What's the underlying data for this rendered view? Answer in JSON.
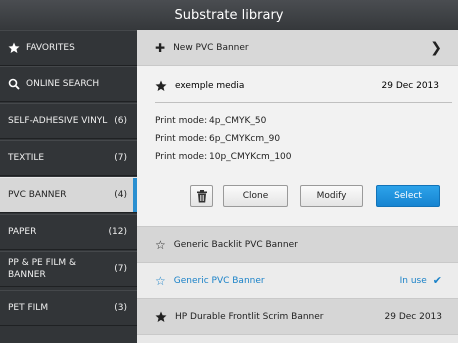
{
  "title": "Substrate library",
  "sidebar": {
    "items": [
      {
        "label": "FAVORITES",
        "count": "",
        "icon": "star-icon"
      },
      {
        "label": "ONLINE SEARCH",
        "count": "",
        "icon": "search-icon"
      },
      {
        "label": "SELF-ADHESIVE VINYL",
        "count": "(6)"
      },
      {
        "label": "TEXTILE",
        "count": "(7)"
      },
      {
        "label": "PVC BANNER",
        "count": "(4)"
      },
      {
        "label": "PAPER",
        "count": "(12)"
      },
      {
        "label": "PP & PE FILM & BANNER",
        "count": "(7)"
      },
      {
        "label": "PET FILM",
        "count": "(3)"
      }
    ]
  },
  "main": {
    "new_label": "New PVC Banner",
    "selected": {
      "name": "exemple media",
      "date": "29 Dec 2013",
      "print_modes": [
        {
          "label": "Print mode:",
          "value": "4p_CMYK_50"
        },
        {
          "label": "Print mode:",
          "value": "6p_CMYKcm_90"
        },
        {
          "label": "Print mode:",
          "value": "10p_CMYKcm_100"
        }
      ],
      "buttons": {
        "clone": "Clone",
        "modify": "Modify",
        "select": "Select"
      }
    },
    "rows": [
      {
        "name": "Generic Backlit PVC Banner",
        "status": "",
        "date": "",
        "favorite": false
      },
      {
        "name": "Generic PVC Banner",
        "status": "In use",
        "date": "",
        "favorite": false
      },
      {
        "name": "HP Durable Frontlit Scrim Banner",
        "status": "",
        "date": "29 Dec 2013",
        "favorite": true
      }
    ]
  },
  "colors": {
    "accent": "#1b82c8",
    "select_button": "#1f93de",
    "sidebar": "#323538"
  }
}
